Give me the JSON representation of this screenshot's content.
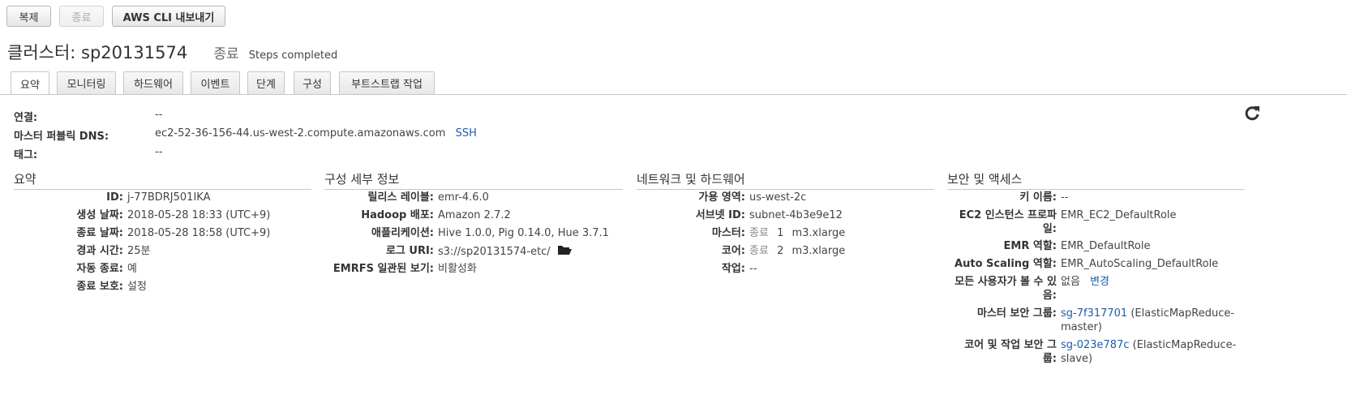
{
  "toolbar": {
    "clone": "복제",
    "terminate": "종료",
    "export": "AWS CLI 내보내기"
  },
  "cluster": {
    "title": "클러스터: sp20131574",
    "state": "종료",
    "state_detail": "Steps completed"
  },
  "tabs": [
    "요약",
    "모니터링",
    "하드웨어",
    "이벤트",
    "단계",
    "구성",
    "부트스트랩 작업"
  ],
  "connection": {
    "connect_label": "연결:",
    "connect_value": "--",
    "dns_label": "마스터 퍼블릭 DNS:",
    "dns_value": "ec2-52-36-156-44.us-west-2.compute.amazonaws.com",
    "ssh_link": "SSH",
    "tags_label": "태그:",
    "tags_value": "--"
  },
  "summary": {
    "heading": "요약",
    "rows": [
      {
        "k": "ID:",
        "v": "j-77BDRJ501IKA"
      },
      {
        "k": "생성 날짜:",
        "v": "2018-05-28 18:33 (UTC+9)"
      },
      {
        "k": "종료 날짜:",
        "v": "2018-05-28 18:58 (UTC+9)"
      },
      {
        "k": "경과 시간:",
        "v": "25분"
      },
      {
        "k": "자동 종료:",
        "v": "예"
      },
      {
        "k": "종료 보호:",
        "v": "설정"
      }
    ]
  },
  "config": {
    "heading": "구성 세부 정보",
    "rows": [
      {
        "k": "릴리스 레이블:",
        "v": "emr-4.6.0"
      },
      {
        "k": "Hadoop 배포:",
        "v": "Amazon 2.7.2"
      },
      {
        "k": "애플리케이션:",
        "v": "Hive 1.0.0, Pig 0.14.0, Hue 3.7.1"
      },
      {
        "k": "로그 URI:",
        "v": "s3://sp20131574-etc/"
      },
      {
        "k": "EMRFS 일관된 보기:",
        "v": "비활성화"
      }
    ]
  },
  "network": {
    "heading": "네트워크 및 하드웨어",
    "az_label": "가용 영역:",
    "az_value": "us-west-2c",
    "subnet_label": "서브넷 ID:",
    "subnet_value": "subnet-4b3e9e12",
    "master_label": "마스터:",
    "master_state": "종료",
    "master_count": "1",
    "master_type": "m3.xlarge",
    "core_label": "코어:",
    "core_state": "종료",
    "core_count": "2",
    "core_type": "m3.xlarge",
    "task_label": "작업:",
    "task_value": "--"
  },
  "security": {
    "heading": "보안 및 액세스",
    "key_label": "키 이름:",
    "key_value": "--",
    "profile_label_1": "EC2 인스턴스 프로파",
    "profile_label_2": "일:",
    "profile_value": "EMR_EC2_DefaultRole",
    "emr_role_label": "EMR 역할:",
    "emr_role_value": "EMR_DefaultRole",
    "as_role_label": "Auto Scaling 역할:",
    "as_role_value": "EMR_AutoScaling_DefaultRole",
    "visible_label_1": "모든 사용자가 볼 수 있",
    "visible_label_2": "음:",
    "visible_value": "없음",
    "visible_change": "변경",
    "master_sg_label": "마스터 보안 그룹:",
    "master_sg_link": "sg-7f317701",
    "master_sg_rest_1": "(ElasticMapReduce-",
    "master_sg_rest_2": "master)",
    "core_sg_label_1": "코어 및 작업 보안 그",
    "core_sg_label_2": "룹:",
    "core_sg_link": "sg-023e787c",
    "core_sg_rest_1": "(ElasticMapReduce-",
    "core_sg_rest_2": "slave)"
  }
}
